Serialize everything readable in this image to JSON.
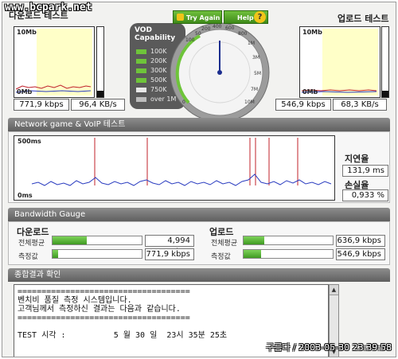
{
  "watermark": "www.bcpark.net",
  "download": {
    "title": "다운로드 테스트",
    "axis_top": "10Mb",
    "axis_bottom": "0Mb",
    "speed_kbps": "771,9 kbps",
    "speed_kBs": "96,4 KB/s"
  },
  "upload": {
    "title": "업로드 테스트",
    "axis_top": "10Mb",
    "axis_bottom": "0Mb",
    "speed_kbps": "546,9 kbps",
    "speed_kBs": "68,3 KB/s"
  },
  "vod": {
    "title_line1": "VOD",
    "title_line2": "Capability",
    "items": [
      {
        "label": "100K",
        "color": "#6ec43a"
      },
      {
        "label": "200K",
        "color": "#6ec43a"
      },
      {
        "label": "300K",
        "color": "#6ec43a"
      },
      {
        "label": "500K",
        "color": "#6ec43a"
      },
      {
        "label": "750K",
        "color": "#e8e8e8"
      },
      {
        "label": "over 1M",
        "color": "#bdbdbd"
      }
    ]
  },
  "gauge": {
    "try_again": "Try Again",
    "help": "Help",
    "help_icon": "?",
    "ticks": [
      "0",
      "50",
      "100",
      "200",
      "400",
      "600",
      "800",
      "1M",
      "3M",
      "5M",
      "7M",
      "10M"
    ]
  },
  "network": {
    "title": "Network game & VoIP 테스트",
    "axis_top": "500ms",
    "axis_bottom": "0ms",
    "latency_label": "지연율",
    "latency_value": "131,9 ms",
    "loss_label": "손실율",
    "loss_value": "0,933 %"
  },
  "bandwidth": {
    "title": "Bandwidth Gauge",
    "download_title": "다운로드",
    "upload_title": "업로드",
    "avg_label": "전체평균",
    "measured_label": "측정값",
    "download_avg": "4,994 Mbps",
    "download_measured": "771,9 kbps",
    "upload_avg": "636,9 kbps",
    "upload_measured": "546,9 kbps",
    "download_avg_fill": 0.38,
    "download_measured_fill": 0.06,
    "upload_avg_fill": 0.23,
    "upload_measured_fill": 0.2
  },
  "summary": {
    "title": "종합결과 확인",
    "line1": "====================================",
    "line2": "벤치비 품질 측정 시스템입니다.",
    "line3": "고객님께서 측정하신 결과는 다음과 같습니다.",
    "line4": "====================================",
    "line5": "",
    "line6": "TEST 시각 :          5 월 30 일  23시 35분 25초"
  },
  "timestamp": "구름다 / 2003-05-30 23:39:58"
}
